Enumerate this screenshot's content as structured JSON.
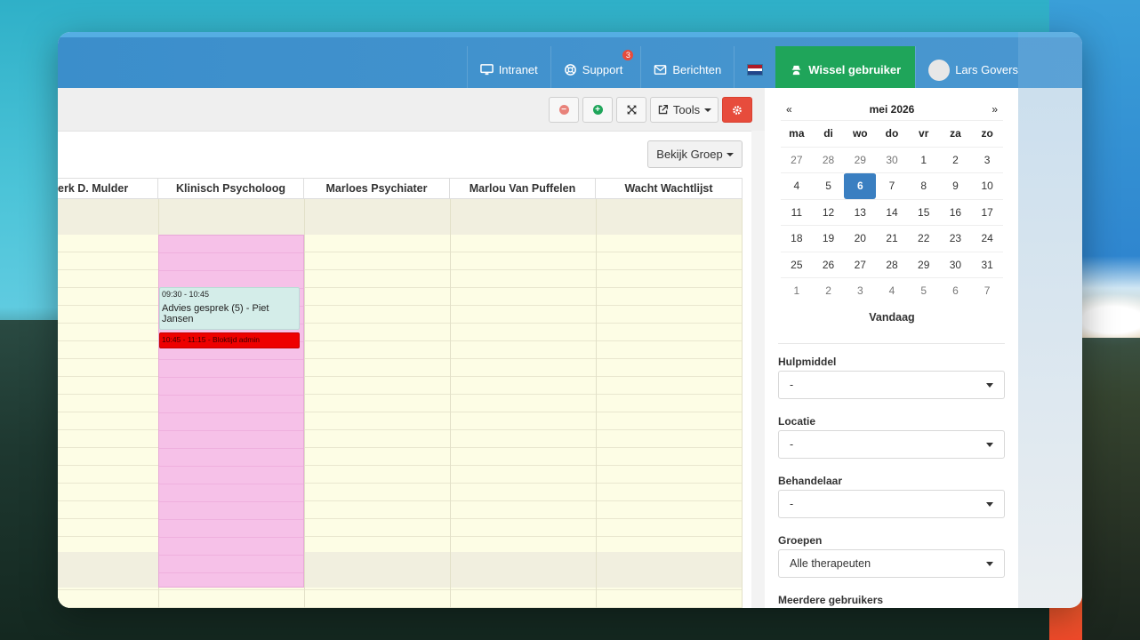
{
  "nav": {
    "intranet": "Intranet",
    "support": "Support",
    "support_badge": "3",
    "berichten": "Berichten",
    "wissel": "Wissel gebruiker",
    "user": "Lars Govers"
  },
  "toolbar": {
    "tools_label": "Tools"
  },
  "agenda": {
    "bekijk_label": "Bekijk Groep",
    "columns": [
      "erk D. Mulder",
      "Klinisch Psycholoog",
      "Marloes Psychiater",
      "Marlou Van Puffelen",
      "Wacht Wachtlijst"
    ],
    "appointment": {
      "time": "09:30 - 10:45",
      "title": "Advies gesprek (5) - Piet Jansen"
    },
    "block": {
      "label": "10:45 - 11:15 - Bloktijd admin"
    }
  },
  "calendar": {
    "prev": "«",
    "next": "»",
    "month": "mei 2026",
    "weekdays": [
      "ma",
      "di",
      "wo",
      "do",
      "vr",
      "za",
      "zo"
    ],
    "days": [
      [
        "27",
        "28",
        "29",
        "30",
        "1",
        "2",
        "3"
      ],
      [
        "4",
        "5",
        "6",
        "7",
        "8",
        "9",
        "10"
      ],
      [
        "11",
        "12",
        "13",
        "14",
        "15",
        "16",
        "17"
      ],
      [
        "18",
        "19",
        "20",
        "21",
        "22",
        "23",
        "24"
      ],
      [
        "25",
        "26",
        "27",
        "28",
        "29",
        "30",
        "31"
      ],
      [
        "1",
        "2",
        "3",
        "4",
        "5",
        "6",
        "7"
      ]
    ],
    "selected": "6",
    "today_label": "Vandaag"
  },
  "filters": {
    "hulpmiddel_label": "Hulpmiddel",
    "hulpmiddel_value": "-",
    "locatie_label": "Locatie",
    "locatie_value": "-",
    "behandelaar_label": "Behandelaar",
    "behandelaar_value": "-",
    "groepen_label": "Groepen",
    "groepen_value": "Alle therapeuten",
    "meerdere_label": "Meerdere gebruikers"
  },
  "colors": {
    "topbar": "#3b8ecb",
    "wissel": "#1fa55a",
    "today": "#3a7fc1",
    "pink_block": "#f6c1e8",
    "red_block": "#ee0000"
  }
}
